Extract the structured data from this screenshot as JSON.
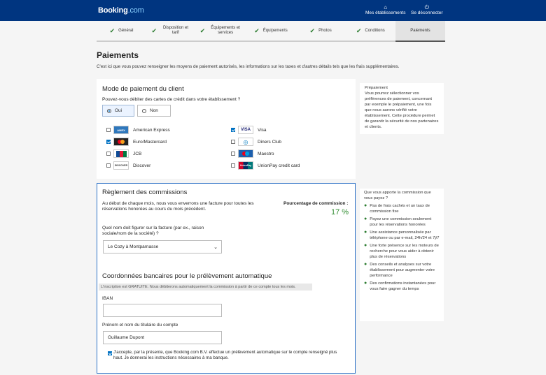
{
  "header": {
    "logo_main": "Booking",
    "logo_dot": ".com",
    "nav": [
      {
        "label": "Mes établissements",
        "icon": "home-icon"
      },
      {
        "label": "Se déconnecter",
        "icon": "power-icon"
      }
    ]
  },
  "tabs": [
    {
      "label": "Général",
      "done": true
    },
    {
      "label": "Disposition et tarif",
      "done": true
    },
    {
      "label": "Équipements et services",
      "done": true
    },
    {
      "label": "Équipements",
      "done": true
    },
    {
      "label": "Photos",
      "done": true
    },
    {
      "label": "Conditions",
      "done": true
    },
    {
      "label": "Paiements",
      "done": false
    }
  ],
  "page": {
    "title": "Paiements",
    "intro": "C'est ici que vous pouvez renseigner les moyens de paiement autorisés, les informations sur les taxes et d'autres détails tels que les frais supplémentaires."
  },
  "payment_mode": {
    "title": "Mode de paiement du client",
    "question": "Pouvez-vous débiter des cartes de crédit dans votre établissement ?",
    "yes": "Oui",
    "no": "Non",
    "cards": [
      {
        "name": "American Express",
        "checked": false
      },
      {
        "name": "Visa",
        "checked": true
      },
      {
        "name": "Euro/Mastercard",
        "checked": true
      },
      {
        "name": "Diners Club",
        "checked": false
      },
      {
        "name": "JCB",
        "checked": false
      },
      {
        "name": "Maestro",
        "checked": false
      },
      {
        "name": "Discover",
        "checked": false
      },
      {
        "name": "UnionPay credit card",
        "checked": false
      }
    ]
  },
  "prepay_note": {
    "title": "Prépaiement",
    "text": "Vous pourrez sélectionner vos préférences de paiement, concernant par exemple le prépaiement, une fois que nous aurons vérifié votre établissement. Cette procédure permet de garantir la sécurité de nos partenaires et clients."
  },
  "commission": {
    "title": "Règlement des commissions",
    "desc": "Au début de chaque mois, nous vous enverrons une facture pour toutes les réservations honorées au cours du mois précédent.",
    "pct_label": "Pourcentage de commission :",
    "pct_value": "17 %",
    "invoice_question": "Quel nom doit figurer sur la facture (par ex., raison sociale/nom de la société) ?",
    "invoice_value": "Le Cozy à Montparnasse"
  },
  "bank": {
    "title": "Coordonnées bancaires pour le prélèvement automatique",
    "notice": "L'inscription est GRATUITE. Nous débiterons automatiquement la commission à partir de ce compte tous les mois.",
    "iban_label": "IBAN",
    "iban_value": "",
    "holder_label": "Prénom et nom du titulaire du compte",
    "holder_value": "Guillaume Dupont",
    "consent": "J'accepte, par la présente, que Booking.com B.V. effectue un prélèvement automatique sur le compte renseigné plus haut. Je donnerai les instructions nécessaires à ma banque."
  },
  "benefits": {
    "title": "Que vous apporte la commission que vous payez ?",
    "items": [
      "Pas de frais cachés et un taux de commission fixe",
      "Payez une commission seulement pour les réservations honorées",
      "Une assistance personnalisée par téléphone ou par e-mail, 24h/24 et 7j/7",
      "Une forte présence sur les moteurs de recherche pour vous aider à obtenir plus de réservations",
      "Des conseils et analyses sur votre établissement pour augmenter votre performance",
      "Des confirmations instantanées pour vous faire gagner du temps"
    ]
  }
}
